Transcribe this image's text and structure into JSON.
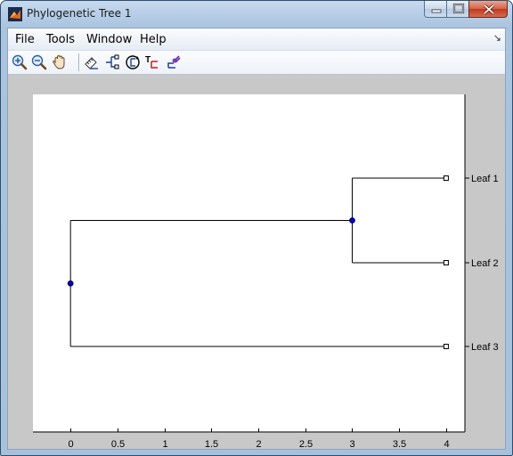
{
  "window": {
    "title": "Phylogenetic Tree 1"
  },
  "menu": {
    "items": [
      "File",
      "Tools",
      "Window",
      "Help"
    ],
    "dock_arrow": "↘"
  },
  "toolbar": {
    "buttons": [
      {
        "icon": "zoom-in-icon"
      },
      {
        "icon": "zoom-out-icon"
      },
      {
        "icon": "pan-hand-icon"
      },
      {
        "icon": "inspect-icon"
      },
      {
        "icon": "collapse-expand-icon"
      },
      {
        "icon": "rotate-branch-icon"
      },
      {
        "icon": "rename-icon"
      },
      {
        "icon": "prune-icon"
      }
    ]
  },
  "tree": {
    "xlim": [
      -0.4,
      4.2
    ],
    "xticks": [
      0,
      0.5,
      1,
      1.5,
      2,
      2.5,
      3,
      3.5,
      4
    ],
    "xtick_labels": [
      "0",
      "0.5",
      "1",
      "1.5",
      "2",
      "2.5",
      "3",
      "3.5",
      "4"
    ],
    "leaves": [
      {
        "label": "Leaf 1",
        "x": 4
      },
      {
        "label": "Leaf 2",
        "x": 4
      },
      {
        "label": "Leaf 3",
        "x": 4
      }
    ],
    "branch_nodes": [
      {
        "x": 0,
        "children": [
          "node2",
          "Leaf 3"
        ]
      },
      {
        "x": 3,
        "children": [
          "Leaf 1",
          "Leaf 2"
        ]
      }
    ],
    "line_color": "#000000",
    "branch_node_color": "#0000c8",
    "leaf_node_color": "#ffffff"
  }
}
